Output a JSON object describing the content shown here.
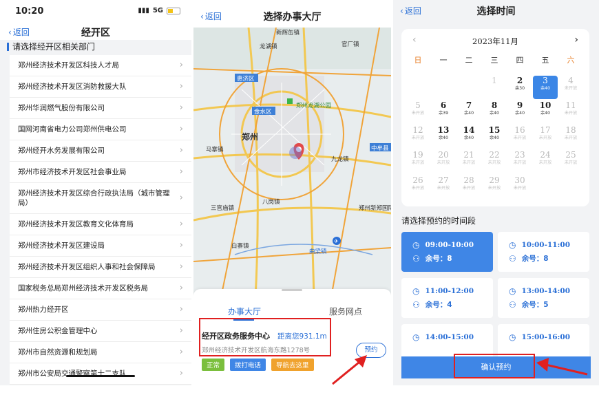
{
  "colors": {
    "accent": "#2a6fd6",
    "highlight": "#e02020",
    "panel_bg": "#f2f3f5"
  },
  "status": {
    "time": "10:20",
    "network": "5G"
  },
  "screen1": {
    "back_label": "返回",
    "title": "经开区",
    "section_label": "请选择经开区相关部门",
    "items": [
      "郑州经济技术开发区科技人才局",
      "郑州经济技术开发区消防救援大队",
      "郑州华润燃气股份有限公司",
      "国网河南省电力公司郑州供电公司",
      "郑州经开水务发展有限公司",
      "郑州市经济技术开发区社会事业局",
      "郑州经济技术开发区综合行政执法局（城市管理局）",
      "郑州经济技术开发区教育文化体育局",
      "郑州经济技术开发区建设局",
      "郑州经济技术开发区组织人事和社会保障局",
      "国家税务总局郑州经济技术开发区税务局",
      "郑州热力经开区",
      "郑州住房公积金管理中心",
      "郑州市自然资源和规划局",
      "郑州市公安局交通警察第十二支队"
    ]
  },
  "screen2": {
    "back_label": "返回",
    "title": "选择办事大厅",
    "map_labels": {
      "l1": "新辉缶镇",
      "l2": "官厂镇",
      "l3": "惠济区",
      "l4": "金水区",
      "l5": "郑州龙湖公园",
      "l6": "郑州",
      "l7": "中牟县",
      "l8": "九龙镇",
      "l9": "龙湖镇",
      "l10": "八岗镇",
      "l11": "郑州新郑国际机场",
      "l12": "曲梁镇",
      "l13": "白寨镇",
      "l14": "三官庙镇",
      "l15": "马寨镇"
    },
    "tabs": [
      "办事大厅",
      "服务网点"
    ],
    "hall": {
      "name": "经开区政务服务中心",
      "distance": "距离您931.1m",
      "address": "郑州经济技术开发区航海东路1278号",
      "book_label": "预约",
      "tags": [
        "正常",
        "拨打电话",
        "导航去这里"
      ]
    }
  },
  "screen3": {
    "back_label": "返回",
    "title": "选择时间",
    "month": "2023年11月",
    "weekdays": [
      "日",
      "一",
      "二",
      "三",
      "四",
      "五",
      "六"
    ],
    "slot_label": "请选择预约的时间段",
    "remaining_prefix": "余号：",
    "confirm_label": "确认预约",
    "selected_day": 3,
    "days": [
      {
        "d": "1",
        "q": "",
        "s": "past"
      },
      {
        "d": "2",
        "q": "余30",
        "s": "open"
      },
      {
        "d": "3",
        "q": "余40",
        "s": "sel"
      },
      {
        "d": "4",
        "q": "未开放",
        "s": "closed"
      },
      {
        "d": "5",
        "q": "未开放",
        "s": "closed"
      },
      {
        "d": "6",
        "q": "余39",
        "s": "open"
      },
      {
        "d": "7",
        "q": "余40",
        "s": "open"
      },
      {
        "d": "8",
        "q": "余40",
        "s": "open"
      },
      {
        "d": "9",
        "q": "余40",
        "s": "open"
      },
      {
        "d": "10",
        "q": "余40",
        "s": "open"
      },
      {
        "d": "11",
        "q": "未开放",
        "s": "closed"
      },
      {
        "d": "12",
        "q": "未开放",
        "s": "closed"
      },
      {
        "d": "13",
        "q": "余40",
        "s": "open"
      },
      {
        "d": "14",
        "q": "余40",
        "s": "open"
      },
      {
        "d": "15",
        "q": "余40",
        "s": "open"
      },
      {
        "d": "16",
        "q": "未开放",
        "s": "closed"
      },
      {
        "d": "17",
        "q": "未开放",
        "s": "closed"
      },
      {
        "d": "18",
        "q": "未开放",
        "s": "closed"
      },
      {
        "d": "19",
        "q": "未开放",
        "s": "closed"
      },
      {
        "d": "20",
        "q": "未开放",
        "s": "closed"
      },
      {
        "d": "21",
        "q": "未开放",
        "s": "closed"
      },
      {
        "d": "22",
        "q": "未开放",
        "s": "closed"
      },
      {
        "d": "23",
        "q": "未开放",
        "s": "closed"
      },
      {
        "d": "24",
        "q": "未开放",
        "s": "closed"
      },
      {
        "d": "25",
        "q": "未开放",
        "s": "closed"
      },
      {
        "d": "26",
        "q": "未开放",
        "s": "closed"
      },
      {
        "d": "27",
        "q": "未开放",
        "s": "closed"
      },
      {
        "d": "28",
        "q": "未开放",
        "s": "closed"
      },
      {
        "d": "29",
        "q": "未开放",
        "s": "closed"
      },
      {
        "d": "30",
        "q": "未开放",
        "s": "closed"
      }
    ],
    "slots": [
      {
        "time": "09:00-10:00",
        "remaining": "8",
        "selected": true
      },
      {
        "time": "10:00-11:00",
        "remaining": "8",
        "selected": false
      },
      {
        "time": "11:00-12:00",
        "remaining": "4",
        "selected": false
      },
      {
        "time": "13:00-14:00",
        "remaining": "5",
        "selected": false
      },
      {
        "time": "14:00-15:00",
        "remaining": "",
        "selected": false
      },
      {
        "time": "15:00-16:00",
        "remaining": "",
        "selected": false
      }
    ]
  }
}
